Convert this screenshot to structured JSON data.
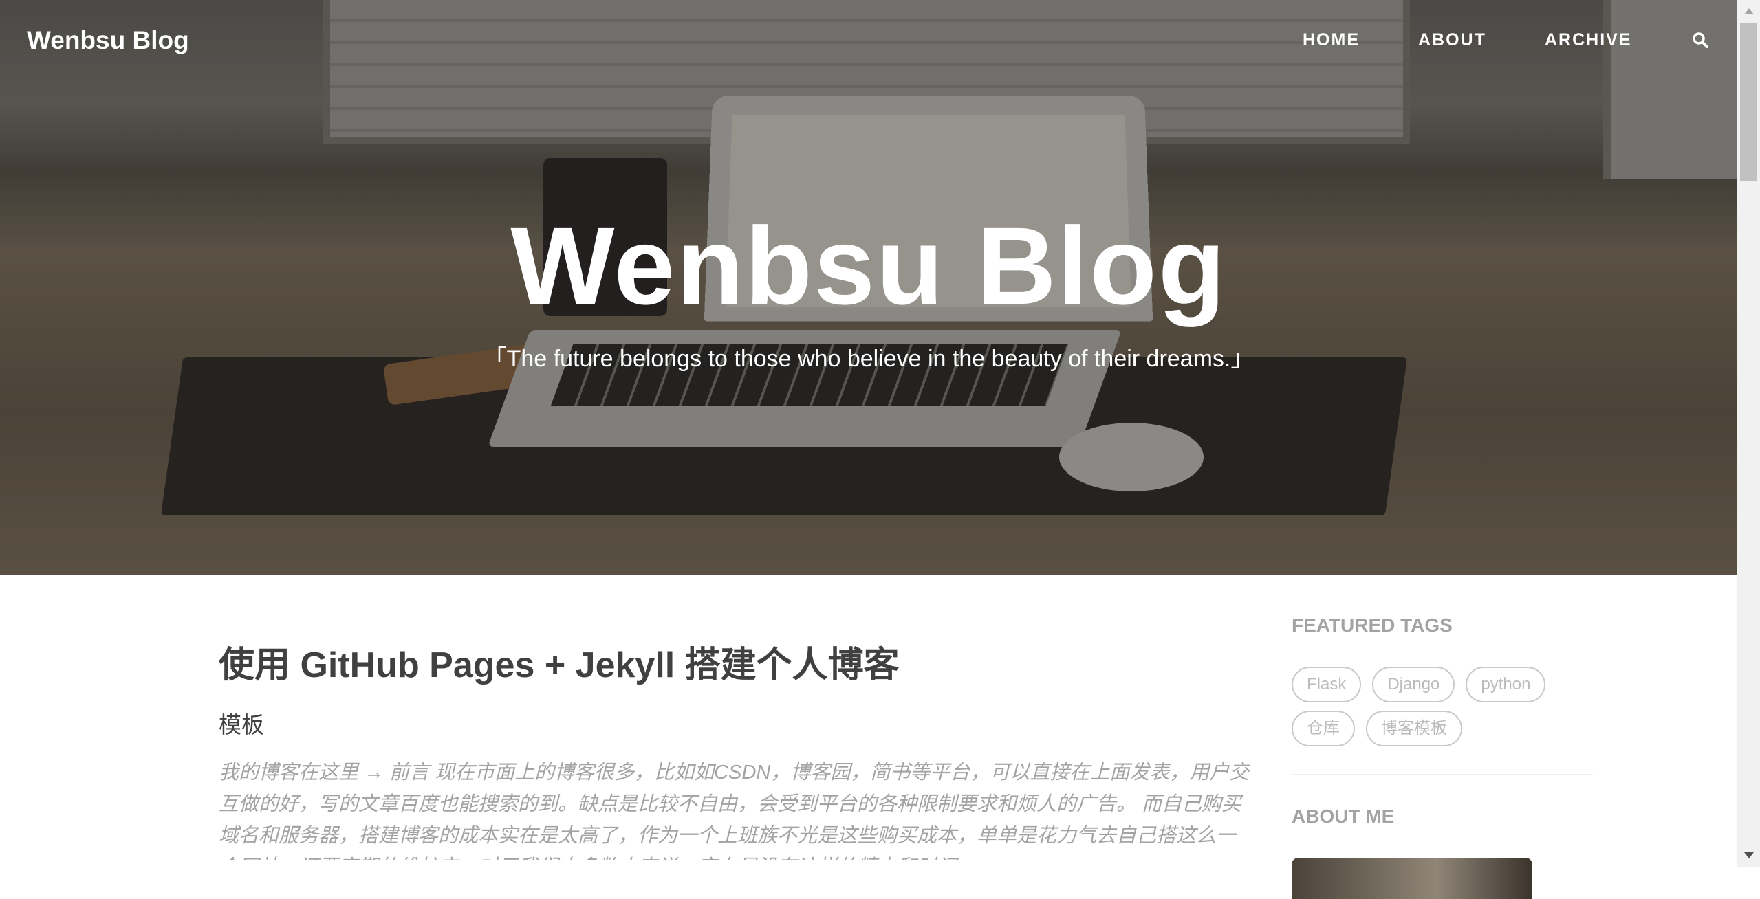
{
  "nav": {
    "brand": "Wenbsu Blog",
    "links": [
      "HOME",
      "ABOUT",
      "ARCHIVE"
    ],
    "search_icon": "search-icon"
  },
  "hero": {
    "title": "Wenbsu Blog",
    "subtitle": "「The future belongs to those who believe in the beauty of their dreams.」"
  },
  "post": {
    "title": "使用 GitHub Pages + Jekyll 搭建个人博客",
    "subtitle": "模板",
    "excerpt": "我的博客在这里 → 前言 现在市面上的博客很多，比如如CSDN，博客园，简书等平台，可以直接在上面发表，用户交互做的好，写的文章百度也能搜索的到。缺点是比较不自由，会受到平台的各种限制要求和烦人的广告。 而自己购买域名和服务器，搭建博客的成本实在是太高了，作为一个上班族不光是这些购买成本，单单是花力气去自己搭这么一个网站，还要定期的维护它，对于我们大多数人来说，实在是没有这样的精力和时间。 ..."
  },
  "sidebar": {
    "featured_tags_heading": "FEATURED TAGS",
    "tags": [
      "Flask",
      "Django",
      "python",
      "仓库",
      "博客模板"
    ],
    "about_heading": "ABOUT ME"
  }
}
